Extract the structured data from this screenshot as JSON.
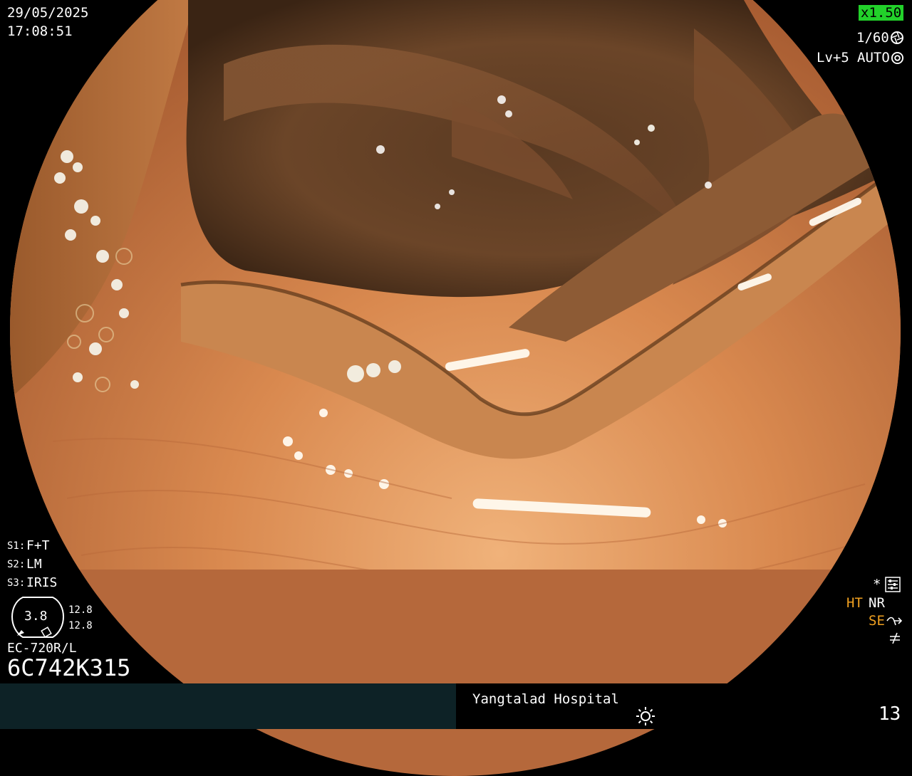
{
  "header": {
    "date": "29/05/2025",
    "time": "17:08:51"
  },
  "top_right": {
    "zoom": "x1.50",
    "shutter": "1/60",
    "shutter_icon": "aperture-icon",
    "level": "Lv+5",
    "mode": "AUTO",
    "mode_icon": "iris-icon",
    "zoom_bg": "#22d12a"
  },
  "settings": {
    "s1_label": "S1:",
    "s1_value": "F+T",
    "s2_label": "S2:",
    "s2_value": "LM",
    "s3_label": "S3:",
    "s3_value": "IRIS"
  },
  "gauge": {
    "center_value": "3.8",
    "side_top": "12.8",
    "side_bottom": "12.8"
  },
  "scope_info": {
    "model": "EC-720R/L",
    "serial": "6C742K315"
  },
  "right_indicators": {
    "star": "*",
    "star_icon": "settings-sliders-icon",
    "ht": "HT",
    "nr": "NR",
    "se": "SE",
    "se_icon": "sharpness-icon",
    "extra_icon": "not-equal-icon",
    "accent": "#f0a020"
  },
  "status_bar": {
    "hospital": "Yangtalad Hospital",
    "light_icon": "sun-icon",
    "frame_number": "13"
  }
}
